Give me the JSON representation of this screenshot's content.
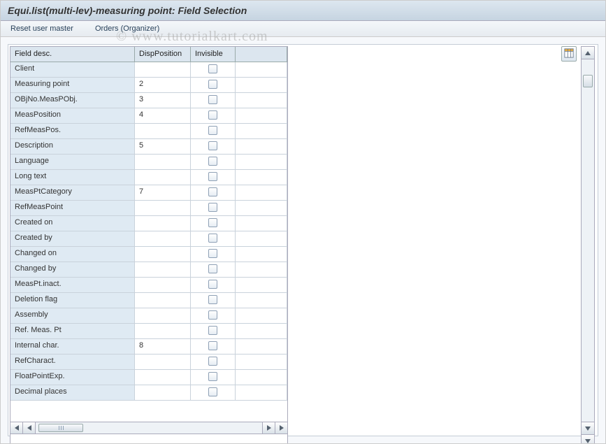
{
  "title": "Equi.list(multi-lev)-measuring point: Field Selection",
  "menubar": {
    "reset_user_master": "Reset user master",
    "orders_organizer": "Orders (Organizer)"
  },
  "watermark": "© www.tutorialkart.com",
  "columns": {
    "field_desc": "Field desc.",
    "disp_position": "DispPosition",
    "invisible": "Invisible"
  },
  "rows": [
    {
      "desc": "Client",
      "pos": "",
      "inv": false
    },
    {
      "desc": "Measuring point",
      "pos": "2",
      "inv": false
    },
    {
      "desc": "OBjNo.MeasPObj.",
      "pos": "3",
      "inv": false
    },
    {
      "desc": "MeasPosition",
      "pos": "4",
      "inv": false
    },
    {
      "desc": "RefMeasPos.",
      "pos": "",
      "inv": false
    },
    {
      "desc": "Description",
      "pos": "5",
      "inv": false
    },
    {
      "desc": "Language",
      "pos": "",
      "inv": false
    },
    {
      "desc": "Long text",
      "pos": "",
      "inv": false
    },
    {
      "desc": "MeasPtCategory",
      "pos": "7",
      "inv": false
    },
    {
      "desc": "RefMeasPoint",
      "pos": "",
      "inv": false
    },
    {
      "desc": "Created on",
      "pos": "",
      "inv": false
    },
    {
      "desc": "Created by",
      "pos": "",
      "inv": false
    },
    {
      "desc": "Changed on",
      "pos": "",
      "inv": false
    },
    {
      "desc": "Changed by",
      "pos": "",
      "inv": false
    },
    {
      "desc": "MeasPt.inact.",
      "pos": "",
      "inv": false
    },
    {
      "desc": "Deletion flag",
      "pos": "",
      "inv": false
    },
    {
      "desc": "Assembly",
      "pos": "",
      "inv": false
    },
    {
      "desc": "Ref. Meas. Pt",
      "pos": "",
      "inv": false
    },
    {
      "desc": "Internal char.",
      "pos": "8",
      "inv": false
    },
    {
      "desc": "RefCharact.",
      "pos": "",
      "inv": false
    },
    {
      "desc": "FloatPointExp.",
      "pos": "",
      "inv": false
    },
    {
      "desc": "Decimal places",
      "pos": "",
      "inv": false
    }
  ],
  "icons": {
    "config": "table-config-icon"
  }
}
